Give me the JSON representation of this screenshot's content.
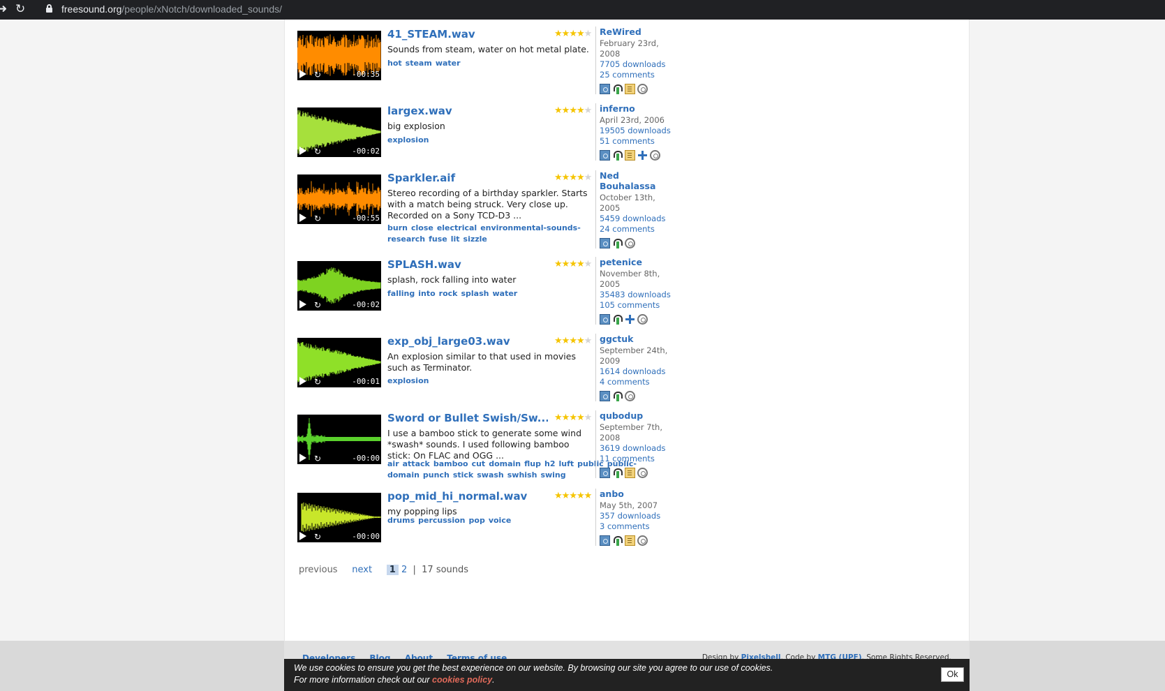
{
  "browser": {
    "url_host": "freesound.org",
    "url_path": "/people/xNotch/downloaded_sounds/"
  },
  "sounds": [
    {
      "title": "41_STEAM.wav",
      "rating": 4.5,
      "description": "Sounds from steam, water on hot metal plate.",
      "tags": [
        "hot",
        "steam",
        "water"
      ],
      "user": "ReWired",
      "date": "February 23rd, 2008",
      "downloads": "7705 downloads",
      "comments": "25 comments",
      "duration": "-00:35",
      "waveform_color": "#ff8c00",
      "icons": [
        "info-icon",
        "headphones-icon",
        "document-icon",
        "license-icon"
      ]
    },
    {
      "title": "largex.wav",
      "rating": 4.5,
      "description": "big explosion",
      "tags": [
        "explosion"
      ],
      "user": "inferno",
      "date": "April 23rd, 2006",
      "downloads": "19505 downloads",
      "comments": "51 comments",
      "duration": "-00:02",
      "waveform_color": "#a6e03c",
      "icons": [
        "info-icon",
        "headphones-icon",
        "document-icon",
        "share-icon",
        "license-icon"
      ]
    },
    {
      "title": "Sparkler.aif",
      "rating": 4.5,
      "description": "Stereo recording of a birthday sparkler. Starts with a match being struck. Very close up. Recorded on a Sony TCD-D3 ...",
      "tags": [
        "burn",
        "close",
        "electrical",
        "environmental-sounds-research",
        "fuse",
        "lit",
        "sizzle"
      ],
      "user": "Ned Bouhalassa",
      "date": "October 13th, 2005",
      "downloads": "5459 downloads",
      "comments": "24 comments",
      "duration": "-00:55",
      "waveform_color": "#ff8c00",
      "icons": [
        "info-icon",
        "headphones-icon",
        "license-icon"
      ]
    },
    {
      "title": "SPLASH.wav",
      "rating": 4.5,
      "description": "splash, rock falling into water",
      "tags": [
        "falling",
        "into",
        "rock",
        "splash",
        "water"
      ],
      "user": "petenice",
      "date": "November 8th, 2005",
      "downloads": "35483 downloads",
      "comments": "105 comments",
      "duration": "-00:02",
      "waveform_color": "#7ed321",
      "icons": [
        "info-icon",
        "headphones-icon",
        "share-icon",
        "license-icon"
      ]
    },
    {
      "title": "exp_obj_large03.wav",
      "rating": 4.5,
      "description": "An explosion similar to that used in movies such as Terminator.",
      "tags": [
        "explosion"
      ],
      "user": "ggctuk",
      "date": "September 24th, 2009",
      "downloads": "1614 downloads",
      "comments": "4 comments",
      "duration": "-00:01",
      "waveform_color": "#8fe028",
      "icons": [
        "info-icon",
        "headphones-icon",
        "license-icon"
      ]
    },
    {
      "title": "Sword or Bullet Swish/Sw...",
      "rating": 4.5,
      "description": "I use a bamboo stick to generate some wind *swash* sounds. I used following bamboo stick: On FLAC and OGG ...",
      "tags": [
        "air",
        "attack",
        "bamboo",
        "cut",
        "domain",
        "flup",
        "h2",
        "luft",
        "public",
        "public-domain",
        "punch",
        "stick",
        "swash",
        "swhish",
        "swing"
      ],
      "user": "qubodup",
      "date": "September 7th, 2008",
      "downloads": "3619 downloads",
      "comments": "11 comments",
      "duration": "-00:00",
      "waveform_color": "#5bd12c",
      "icons": [
        "info-icon",
        "headphones-icon",
        "document-icon",
        "license-icon"
      ]
    },
    {
      "title": "pop_mid_hi_normal.wav",
      "rating": 5,
      "description": "my popping lips",
      "tags": [
        "drums",
        "percussion",
        "pop",
        "voice"
      ],
      "user": "anbo",
      "date": "May 5th, 2007",
      "downloads": "357 downloads",
      "comments": "3 comments",
      "duration": "-00:00",
      "waveform_color": "#c8e62a",
      "icons": [
        "info-icon",
        "headphones-icon",
        "document-icon",
        "license-icon"
      ]
    }
  ],
  "pager": {
    "previous": "previous",
    "next": "next",
    "pages": [
      "1",
      "2"
    ],
    "separator": "|",
    "count": "17 sounds"
  },
  "footer": {
    "links": [
      "Developers",
      "Blog",
      "About",
      "Terms of use"
    ],
    "design_by": "Design by",
    "pixelshell": "Pixelshell",
    "code_by": ". Code by",
    "mtg": "MTG (UPF)",
    "rights": ". Some Rights Reserved."
  },
  "cookie": {
    "line1": "We use cookies to ensure you get the best experience on our website. By browsing our site you agree to our use of cookies.",
    "line2_prefix": "For more information check out our",
    "policy_link": "cookies policy",
    "line2_suffix": ".",
    "ok_label": "Ok"
  }
}
